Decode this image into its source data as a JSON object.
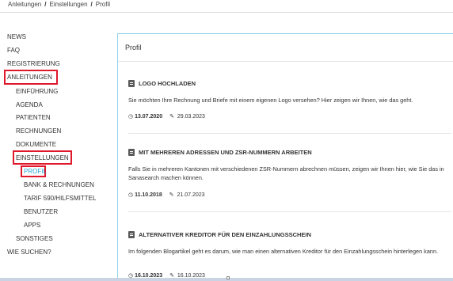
{
  "breadcrumb": {
    "items": [
      "Anleitungen",
      "Einstellungen",
      "Profil"
    ],
    "separator": "/"
  },
  "sidebar": {
    "items": [
      {
        "label": "NEWS"
      },
      {
        "label": "FAQ"
      },
      {
        "label": "REGISTRIERUNG"
      },
      {
        "label": "ANLEITUNGEN"
      },
      {
        "label": "EINFÜHRUNG"
      },
      {
        "label": "AGENDA"
      },
      {
        "label": "PATIENTEN"
      },
      {
        "label": "RECHNUNGEN"
      },
      {
        "label": "DOKUMENTE"
      },
      {
        "label": "EINSTELLUNGEN"
      },
      {
        "label": "PROFIL"
      },
      {
        "label": "BANK & RECHNUNGEN"
      },
      {
        "label": "TARIF 590/HILFSMITTEL"
      },
      {
        "label": "BENUTZER"
      },
      {
        "label": "APPS"
      },
      {
        "label": "SONSTIGES"
      },
      {
        "label": "WIE SUCHEN?"
      }
    ],
    "active_color": "#26a8d8",
    "highlight_color": "#e0182c"
  },
  "panel": {
    "title": "Profil",
    "border_color": "#8fd3eb",
    "articles": [
      {
        "title": "LOGO HOCHLADEN",
        "text": "Sie möchten Ihre Rechnung und Briefe mit einem eigenen Logo versehen? Hier zeigen wir Ihnen, wie das geht.",
        "created": "13.07.2020",
        "updated": "29.03.2023"
      },
      {
        "title": "MIT MEHREREN ADRESSEN UND ZSR-NUMMERN ARBEITEN",
        "text": "Falls Sie in mehreren Kantonen mit verschiedenen ZSR-Nummern abrechnen müssen, zeigen wir Ihnen hier, wie Sie das in Sanasearch machen können.",
        "created": "11.10.2018",
        "updated": "21.07.2023"
      },
      {
        "title": "ALTERNATIVER KREDITOR FÜR DEN EINZAHLUNGSSCHEIN",
        "text": "Im folgenden Blogartikel geht es darum, wie man einen alternativen Kreditor für den Einzahlungsschein hinterlegen kann.",
        "created": "16.10.2023",
        "updated": "16.10.2023"
      }
    ]
  },
  "icons": {
    "clock": "clock-icon",
    "pencil": "pencil-icon",
    "document": "document-icon"
  }
}
